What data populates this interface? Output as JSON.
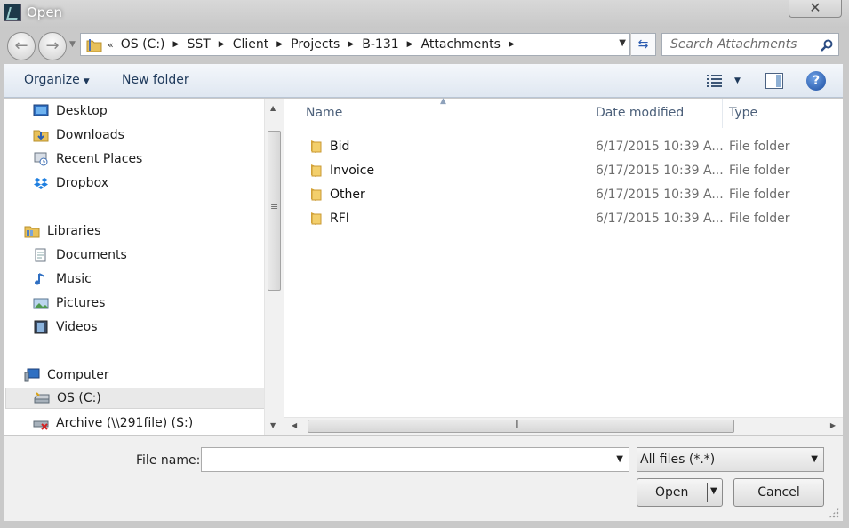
{
  "window": {
    "title": "Open"
  },
  "breadcrumb": {
    "overflow": "«",
    "items": [
      "OS (C:)",
      "SST",
      "Client",
      "Projects",
      "B-131",
      "Attachments"
    ]
  },
  "search": {
    "placeholder": "Search Attachments"
  },
  "toolbar": {
    "organize_label": "Organize",
    "new_folder_label": "New folder"
  },
  "sidebar": {
    "favorites": [
      {
        "label": "Desktop",
        "icon": "desktop-icon"
      },
      {
        "label": "Downloads",
        "icon": "downloads-icon"
      },
      {
        "label": "Recent Places",
        "icon": "recent-places-icon"
      },
      {
        "label": "Dropbox",
        "icon": "dropbox-icon"
      }
    ],
    "libraries_label": "Libraries",
    "libraries": [
      {
        "label": "Documents",
        "icon": "documents-icon"
      },
      {
        "label": "Music",
        "icon": "music-icon"
      },
      {
        "label": "Pictures",
        "icon": "pictures-icon"
      },
      {
        "label": "Videos",
        "icon": "videos-icon"
      }
    ],
    "computer_label": "Computer",
    "drives": [
      {
        "label": "OS (C:)",
        "icon": "drive-icon",
        "selected": true
      },
      {
        "label": "Archive (\\\\291file) (S:)",
        "icon": "network-drive-disconnected-icon"
      }
    ]
  },
  "filelist": {
    "columns": {
      "name": "Name",
      "date": "Date modified",
      "type": "Type"
    },
    "rows": [
      {
        "name": "Bid",
        "date": "6/17/2015 10:39 A...",
        "type": "File folder"
      },
      {
        "name": "Invoice",
        "date": "6/17/2015 10:39 A...",
        "type": "File folder"
      },
      {
        "name": "Other",
        "date": "6/17/2015 10:39 A...",
        "type": "File folder"
      },
      {
        "name": "RFI",
        "date": "6/17/2015 10:39 A...",
        "type": "File folder"
      }
    ]
  },
  "footer": {
    "filename_label": "File name:",
    "filename_value": "",
    "filter_value": "All files (*.*)",
    "open_label": "Open",
    "cancel_label": "Cancel"
  },
  "colors": {
    "toolbar_text": "#1e395b",
    "selection": "#e9e9e9",
    "folder": "#e8c15a"
  }
}
